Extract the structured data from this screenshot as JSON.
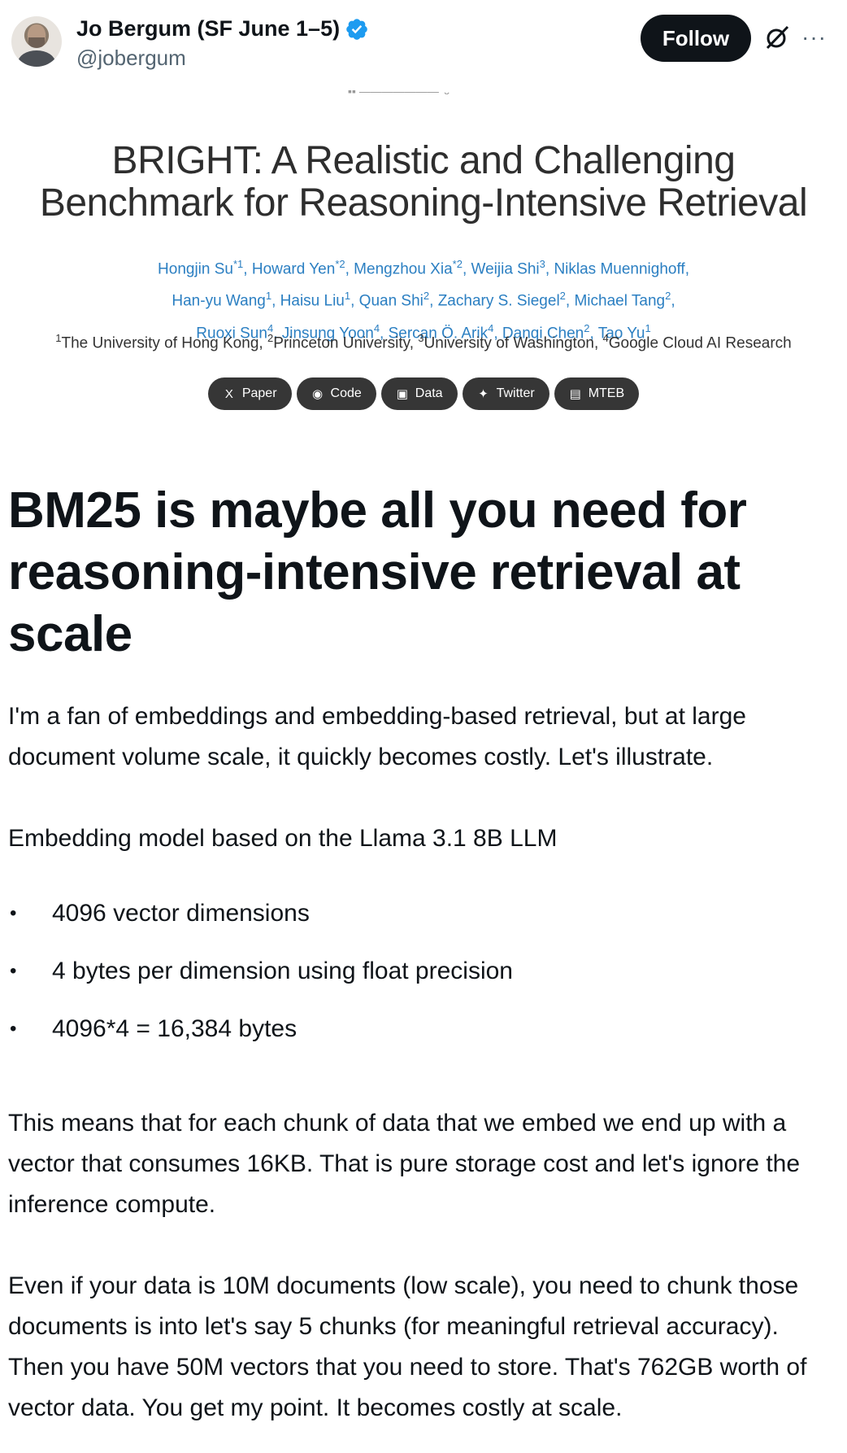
{
  "header": {
    "author_name": "Jo Bergum (SF June 1–5)",
    "handle": "@jobergum",
    "follow_label": "Follow",
    "more_label": "···",
    "verified_color": "#1d9bf0"
  },
  "paper": {
    "title_line1": "BRIGHT: A Realistic and Challenging",
    "title_line2": "Benchmark for Reasoning-Intensive Retrieval",
    "authors_line1": [
      {
        "name": "Hongjin Su",
        "sup": "*1"
      },
      {
        "name": "Howard Yen",
        "sup": "*2"
      },
      {
        "name": "Mengzhou Xia",
        "sup": "*2"
      },
      {
        "name": "Weijia Shi",
        "sup": "3"
      },
      {
        "name": "Niklas Muennighoff",
        "sup": ""
      }
    ],
    "authors_line2": [
      {
        "name": "Han-yu Wang",
        "sup": "1"
      },
      {
        "name": "Haisu Liu",
        "sup": "1"
      },
      {
        "name": "Quan Shi",
        "sup": "2"
      },
      {
        "name": "Zachary S. Siegel",
        "sup": "2"
      },
      {
        "name": "Michael Tang",
        "sup": "2"
      }
    ],
    "authors_line3": [
      {
        "name": "Ruoxi Sun",
        "sup": "4"
      },
      {
        "name": "Jinsung Yoon",
        "sup": "4"
      },
      {
        "name": "Sercan Ö. Arik",
        "sup": "4"
      },
      {
        "name": "Danqi Chen",
        "sup": "2"
      },
      {
        "name": "Tao Yu",
        "sup": "1"
      }
    ],
    "affiliations": [
      {
        "sup": "1",
        "name": "The University of Hong Kong"
      },
      {
        "sup": "2",
        "name": "Princeton University"
      },
      {
        "sup": "3",
        "name": "University of Washington"
      },
      {
        "sup": "4",
        "name": "Google Cloud AI Research"
      }
    ],
    "buttons": [
      {
        "label": "Paper",
        "icon": "arxiv-icon",
        "glyph": "X"
      },
      {
        "label": "Code",
        "icon": "github-icon",
        "glyph": "◉"
      },
      {
        "label": "Data",
        "icon": "image-icon",
        "glyph": "▣"
      },
      {
        "label": "Twitter",
        "icon": "twitter-icon",
        "glyph": "✦"
      },
      {
        "label": "MTEB",
        "icon": "book-icon",
        "glyph": "▤"
      }
    ],
    "link_color": "#2b7fc2"
  },
  "article": {
    "title": "BM25 is maybe all you need for reasoning-intensive retrieval at scale",
    "para1": "I'm a fan of embeddings and embedding-based retrieval, but at large document volume scale, it quickly becomes costly.  Let's illustrate.",
    "para2": "Embedding model based on the Llama 3.1  8B LLM",
    "bullets": [
      "4096 vector dimensions",
      "4 bytes per dimension using float precision",
      "4096*4 = 16,384 bytes"
    ],
    "para3": "This means that for each chunk of data that we embed we end up with a vector that consumes 16KB. That is pure storage cost and let's ignore the inference compute.",
    "para4": "Even if your data is 10M documents (low scale), you need to chunk those documents is into let's say 5 chunks (for meaningful retrieval accuracy). Then you have 50M vectors that you need to store. That's 762GB worth of vector data.  You get my point. It becomes costly at scale."
  }
}
